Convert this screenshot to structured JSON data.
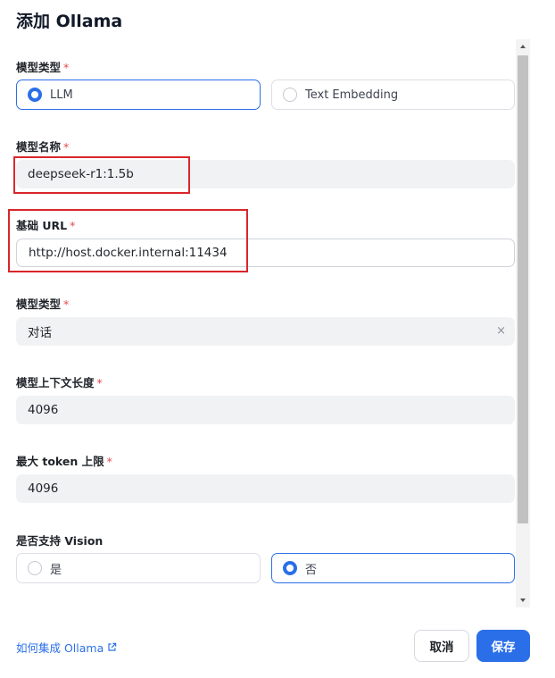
{
  "dialog": {
    "title": "添加 Ollama"
  },
  "fields": {
    "model_category": {
      "label": "模型类型",
      "required_mark": "*",
      "options": [
        {
          "label": "LLM",
          "selected": true
        },
        {
          "label": "Text Embedding",
          "selected": false
        }
      ]
    },
    "model_name": {
      "label": "模型名称",
      "required_mark": "*",
      "value": "deepseek-r1:1.5b"
    },
    "base_url": {
      "label": "基础 URL",
      "required_mark": "*",
      "value": "http://host.docker.internal:11434"
    },
    "model_type": {
      "label": "模型类型",
      "required_mark": "*",
      "value": "对话",
      "clear_icon": "×"
    },
    "context_length": {
      "label": "模型上下文长度",
      "required_mark": "*",
      "value": "4096"
    },
    "max_tokens": {
      "label": "最大 token 上限",
      "required_mark": "*",
      "value": "4096"
    },
    "vision": {
      "label": "是否支持 Vision",
      "options": [
        {
          "label": "是",
          "selected": false
        },
        {
          "label": "否",
          "selected": true
        }
      ]
    }
  },
  "footer": {
    "help_link": "如何集成 Ollama",
    "cancel_label": "取消",
    "save_label": "保存"
  },
  "colors": {
    "accent": "#2b6fe8",
    "required": "#e5484d",
    "annotation": "#d9262b"
  }
}
